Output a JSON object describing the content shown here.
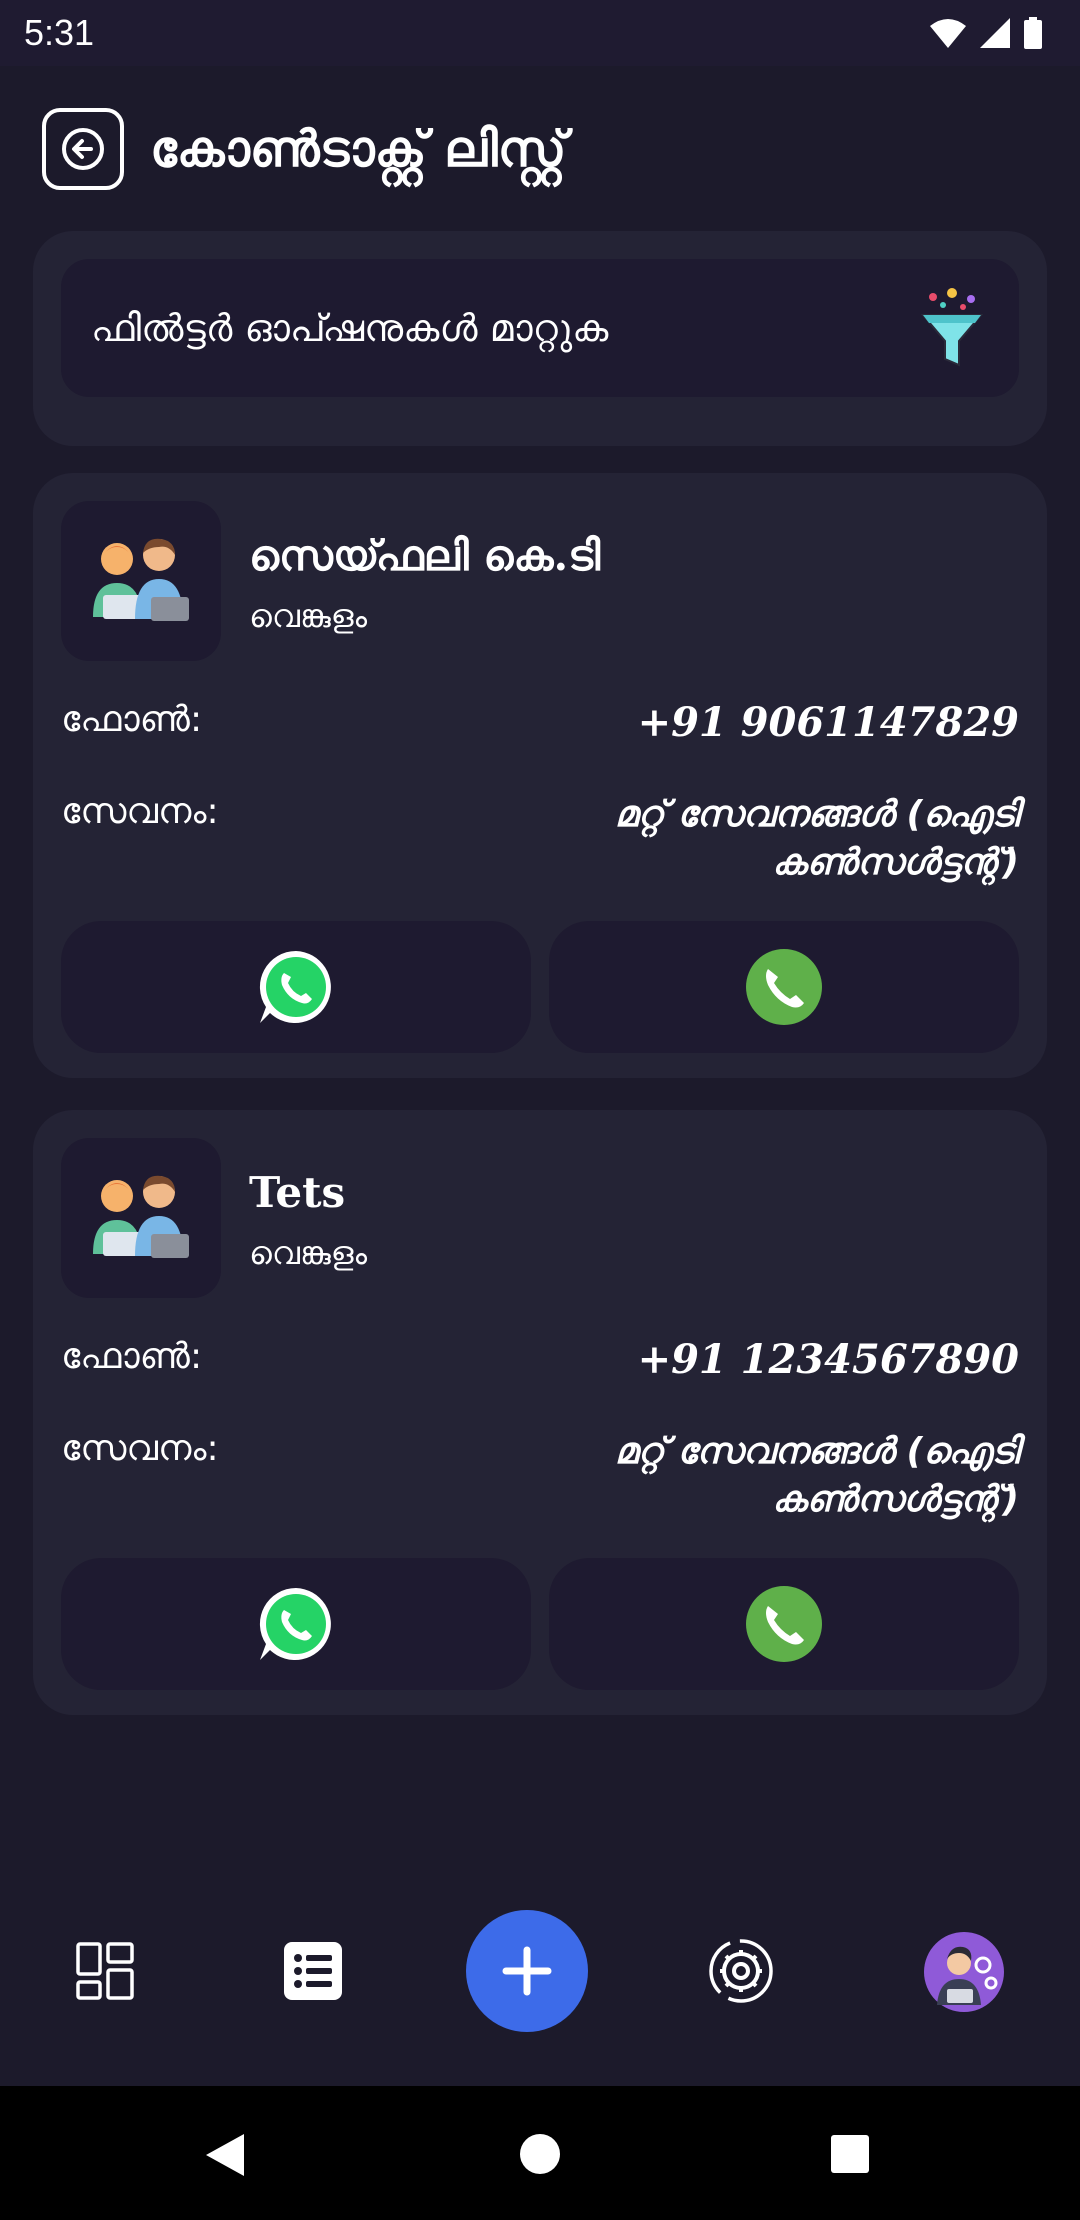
{
  "status_bar": {
    "time": "5:31"
  },
  "header": {
    "title": "കോൺടാക്റ്റ് ലിസ്റ്റ്"
  },
  "filter": {
    "label": "ഫിൽട്ടർ ഓപ്ഷനുകൾ മാറ്റുക"
  },
  "contacts": [
    {
      "name": "സെയ്ഫലി കെ.ടി",
      "location": "വെങ്കുളം",
      "phone_label": "ഫോൺ:",
      "phone": "+91 9061147829",
      "service_label": "സേവനം:",
      "service_line1": "മറ്റ് സേവനങ്ങൾ (ഐടി",
      "service_line2": "കൺസൾട്ടന്റ്)"
    },
    {
      "name": "Tets",
      "location": "വെങ്കുളം",
      "phone_label": "ഫോൺ:",
      "phone": "+91 1234567890",
      "service_label": "സേവനം:",
      "service_line1": "മറ്റ് സേവനങ്ങൾ (ഐടി",
      "service_line2": "കൺസൾട്ടന്റ്)"
    }
  ],
  "icons": {
    "back": "back-arrow-icon",
    "filter": "funnel-icon",
    "whatsapp": "whatsapp-icon",
    "call": "phone-icon",
    "nav": [
      "dashboard-icon",
      "list-icon",
      "plus-icon",
      "settings-icon",
      "profile-avatar"
    ]
  },
  "colors": {
    "background": "#1c1a2b",
    "card": "#242335",
    "inner": "#1e1a30",
    "fab": "#3d6be9",
    "whatsapp": "#25d366",
    "call": "#5fb04a"
  }
}
